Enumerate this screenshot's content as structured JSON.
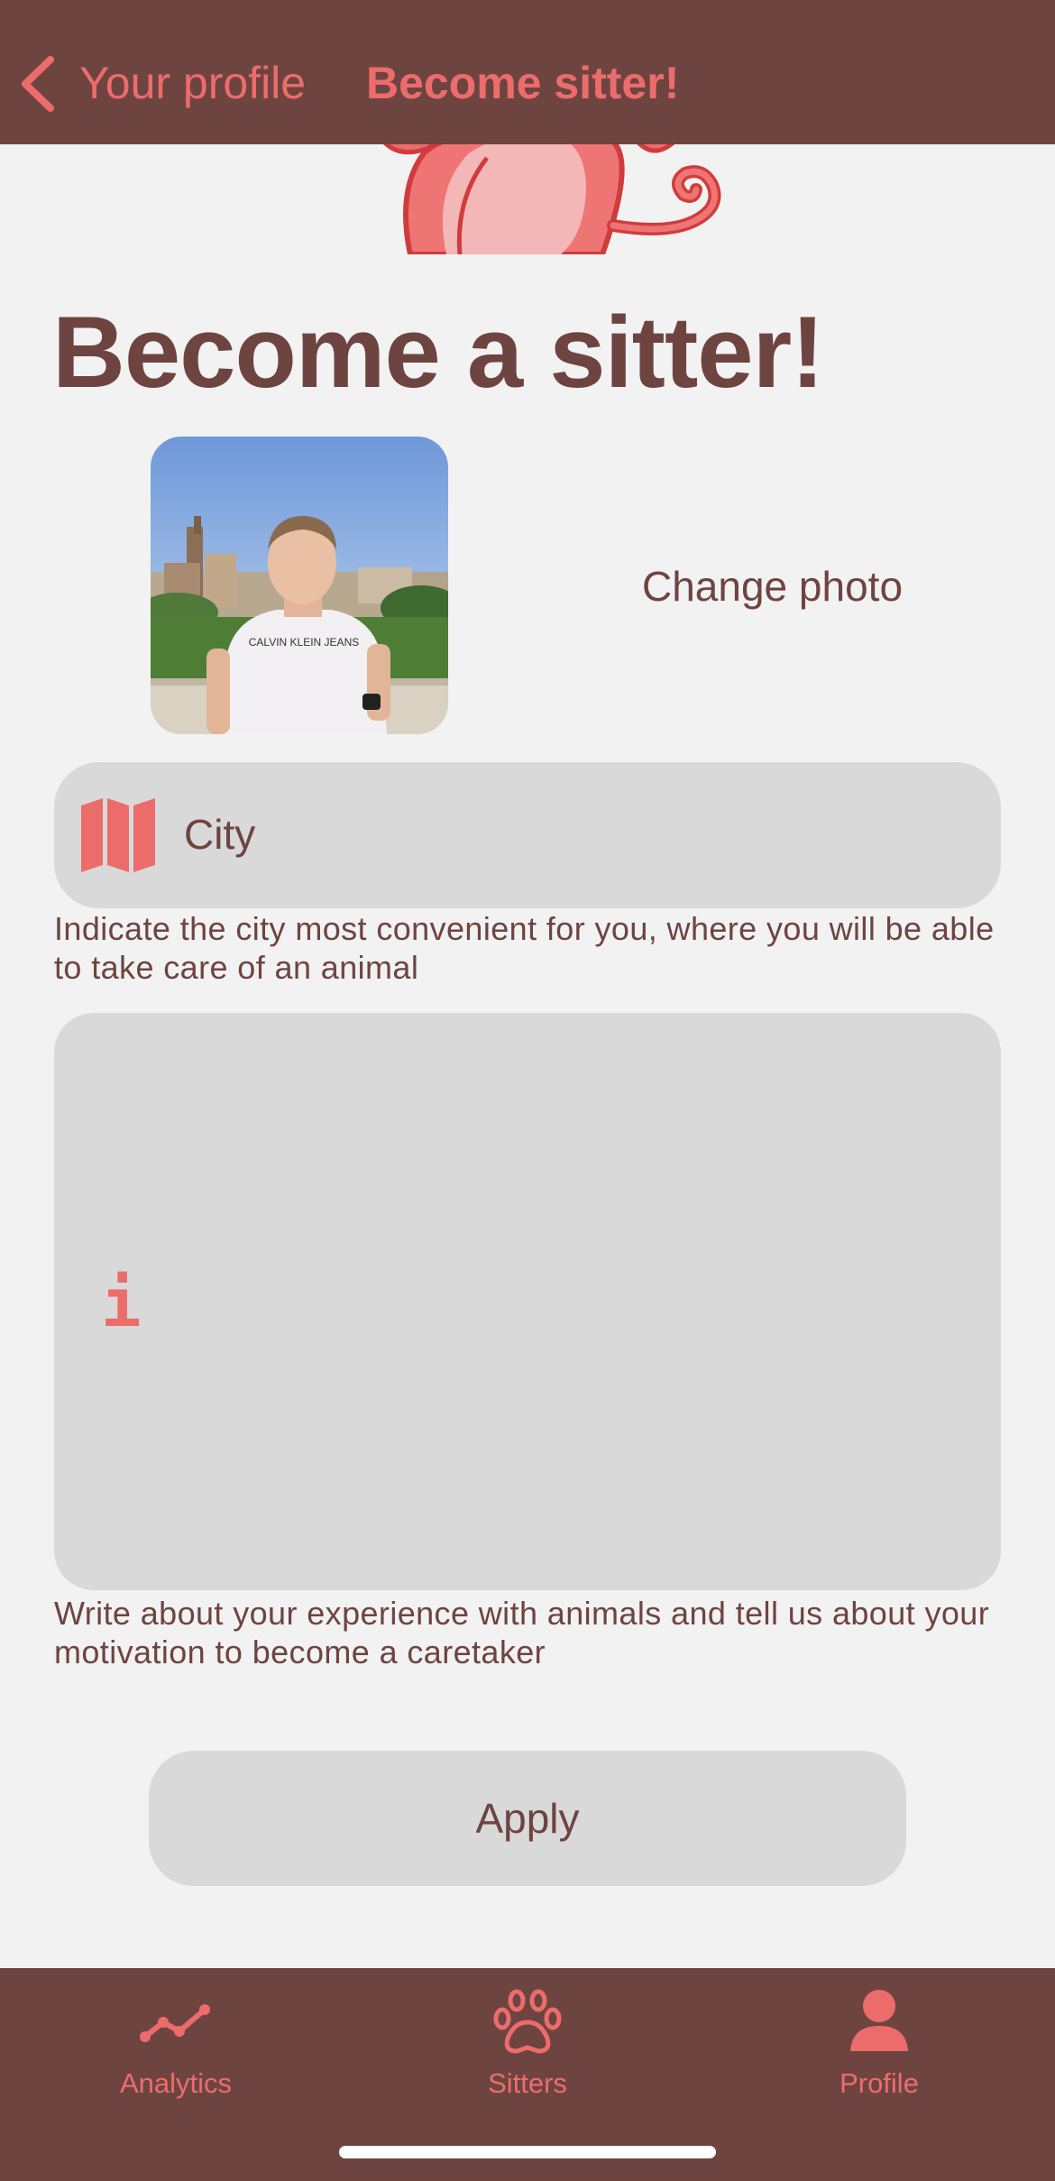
{
  "header": {
    "back_label": "Your profile",
    "title": "Become sitter!",
    "back_icon": "chevron-left-icon"
  },
  "page": {
    "title": "Become a sitter!"
  },
  "photo": {
    "change_label": "Change photo",
    "shirt_text": "CALVIN KLEIN JEANS"
  },
  "city_field": {
    "value": "City",
    "icon": "map-icon",
    "hint": "Indicate the city most convenient for you, where you will be able to take care of an animal"
  },
  "about_field": {
    "icon": "info-icon",
    "icon_glyph": "i",
    "hint": "Write about your experience with animals and tell us about your motivation to become a caretaker"
  },
  "apply_button": {
    "label": "Apply"
  },
  "tabbar": {
    "tabs": [
      {
        "label": "Analytics",
        "icon": "analytics-icon"
      },
      {
        "label": "Sitters",
        "icon": "paw-icon"
      },
      {
        "label": "Profile",
        "icon": "person-icon"
      }
    ],
    "active": "Profile"
  },
  "colors": {
    "brand_dark": "#6e4441",
    "accent": "#ec6c6c",
    "field_bg": "#d9d9d9",
    "page_bg": "#f2f2f2"
  }
}
